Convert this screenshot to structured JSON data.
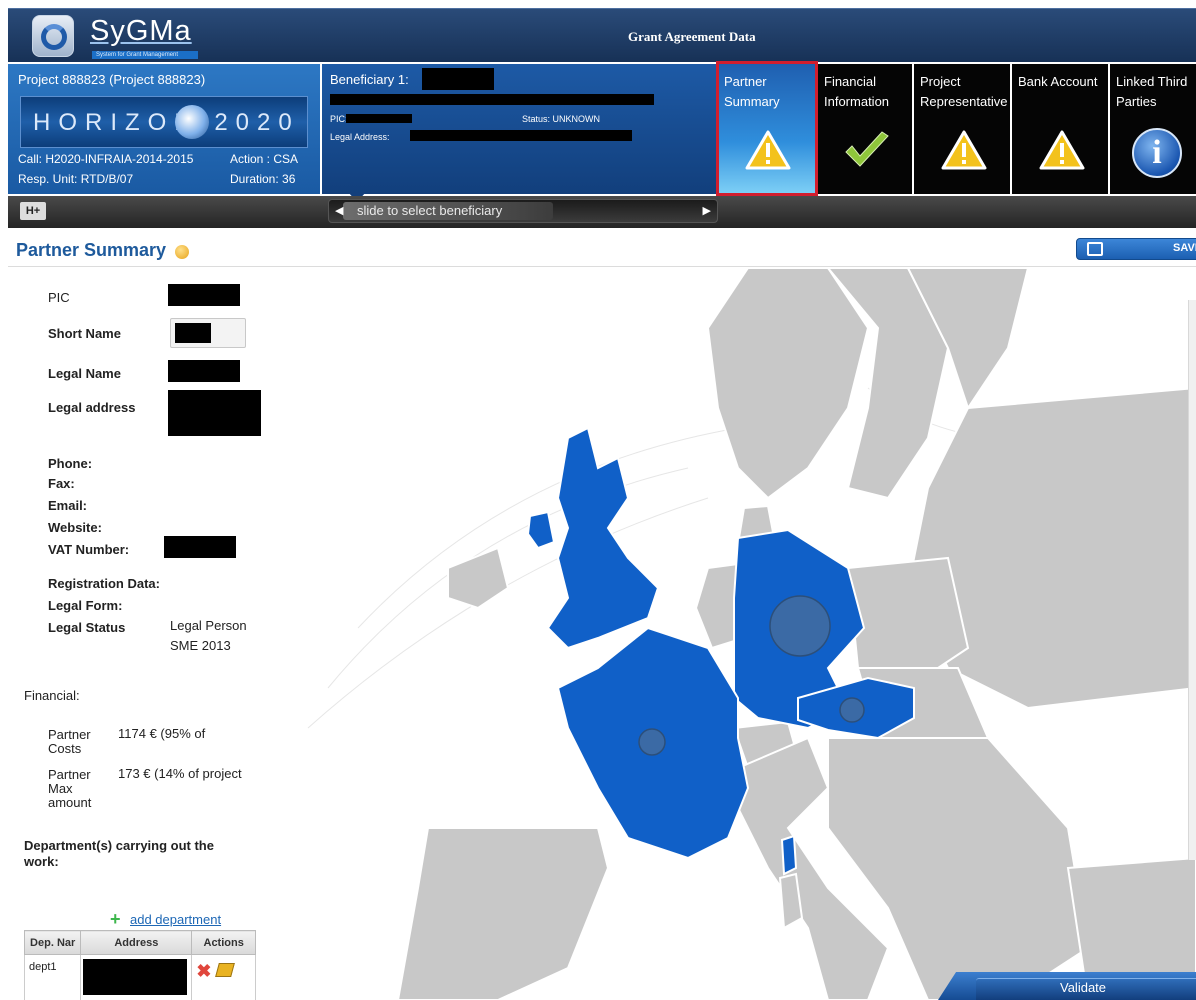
{
  "header": {
    "logo_text": "SyGMa",
    "logo_subtitle": "System for Grant Management",
    "app_title": "Grant Agreement Data"
  },
  "project": {
    "title": "Project 888823 (Project 888823)",
    "programme": "HORIZON 2020",
    "call": "Call: H2020-INFRAIA-2014-2015",
    "action": "Action : CSA",
    "unit": "Resp. Unit: RTD/B/07",
    "duration": "Duration: 36"
  },
  "beneficiary": {
    "title": "Beneficiary 1:",
    "pic_label": "PIC:",
    "status": "Status: UNKNOWN",
    "legal_address_label": "Legal Address:"
  },
  "tabs": [
    {
      "label": "Partner Summary",
      "icon": "warning-icon",
      "active": true
    },
    {
      "label": "Financial Information",
      "icon": "check-icon",
      "active": false
    },
    {
      "label": "Project Representative",
      "icon": "warning-icon",
      "active": false
    },
    {
      "label": "Bank Account",
      "icon": "warning-icon",
      "active": false
    },
    {
      "label": "Linked Third Parties",
      "icon": "info-icon",
      "active": false
    }
  ],
  "slidebar": {
    "h_button": "H+",
    "slider_text": "slide to select beneficiary"
  },
  "page": {
    "title": "Partner Summary",
    "save_label": "SAVE"
  },
  "partner": {
    "pic_label": "PIC",
    "short_name_label": "Short Name",
    "legal_name_label": "Legal Name",
    "legal_address_label": "Legal address",
    "phone_label": "Phone:",
    "fax_label": "Fax:",
    "email_label": "Email:",
    "website_label": "Website:",
    "vat_label": "VAT Number:",
    "registration_label": "Registration Data:",
    "legal_form_label": "Legal Form:",
    "legal_status_label": "Legal Status",
    "legal_status_value_1": "Legal Person",
    "legal_status_value_2": "SME 2013"
  },
  "financial": {
    "heading": "Financial:",
    "costs_label": "Partner Costs",
    "costs_value": "1174 € (95% of",
    "max_label": "Partner Max amount",
    "max_value": "173 € (14% of project"
  },
  "departments": {
    "heading": "Department(s) carrying out the work:",
    "add_label": "add department",
    "columns": [
      "Dep. Nar",
      "Address",
      "Actions"
    ],
    "rows": [
      {
        "name": "dept1"
      }
    ]
  },
  "footer": {
    "validate_label": "Validate"
  },
  "colors": {
    "accent_blue": "#1d5aa6",
    "highlight_red": "#d21e2e",
    "map_country": "#c8c8c8",
    "map_highlight": "#1060c8"
  }
}
